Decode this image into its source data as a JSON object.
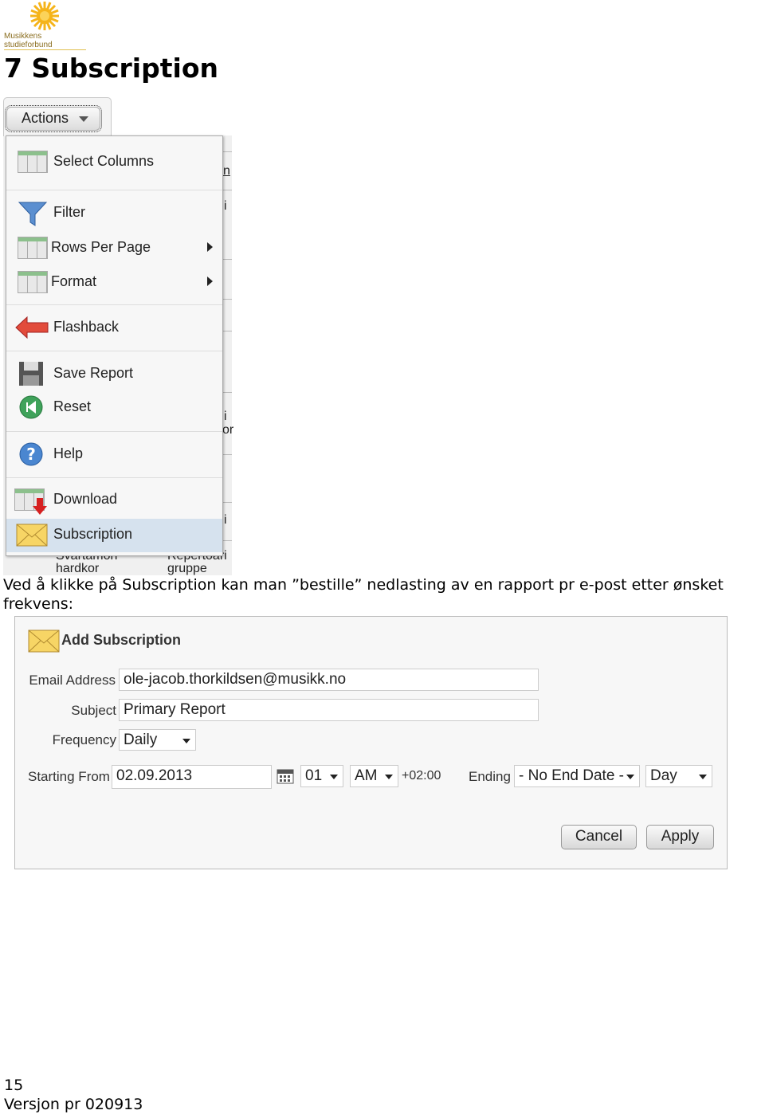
{
  "header": {
    "logo_text": "Musikkens studieforbund",
    "title": "7 Subscription"
  },
  "colors": {
    "menu_highlight": "#d6e2ee",
    "logo": "#f5b41a"
  },
  "actions_menu": {
    "button_label": "Actions",
    "items": [
      {
        "label": "Select Columns",
        "icon": "table-columns-icon",
        "submenu": false
      },
      {
        "label": "Filter",
        "icon": "funnel-icon",
        "submenu": false
      },
      {
        "label": "Rows Per Page",
        "icon": "table-icon",
        "submenu": true
      },
      {
        "label": "Format",
        "icon": "table-icon",
        "submenu": true
      },
      {
        "label": "Flashback",
        "icon": "arrow-left-icon",
        "submenu": false
      },
      {
        "label": "Save Report",
        "icon": "floppy-disk-icon",
        "submenu": false
      },
      {
        "label": "Reset",
        "icon": "reset-icon",
        "submenu": false
      },
      {
        "label": "Help",
        "icon": "help-icon",
        "submenu": false
      },
      {
        "label": "Download",
        "icon": "download-icon",
        "submenu": false
      },
      {
        "label": "Subscription",
        "icon": "envelope-icon",
        "submenu": false,
        "highlighted": true
      }
    ]
  },
  "background_table": {
    "fragments": [
      "n",
      "i",
      "i",
      "or",
      "i",
      "Svartamon hardkor",
      "Repertoari gruppe"
    ]
  },
  "body_text": "Ved å klikke på Subscription kan man ”bestille” nedlasting av en rapport pr e-post etter ønsket frekvens:",
  "subscription_form": {
    "title": "Add Subscription",
    "email_label": "Email Address",
    "email_value": "ole-jacob.thorkildsen@musikk.no",
    "subject_label": "Subject",
    "subject_value": "Primary Report",
    "frequency_label": "Frequency",
    "frequency_value": "Daily",
    "starting_label": "Starting From",
    "starting_value": "02.09.2013",
    "hour_value": "01",
    "ampm_value": "AM",
    "timezone": "+02:00",
    "ending_label": "Ending",
    "ending_value": "- No End Date -",
    "ending_unit": "Day",
    "cancel_label": "Cancel",
    "apply_label": "Apply"
  },
  "footer": {
    "page_number": "15",
    "version": "Versjon pr 020913"
  }
}
